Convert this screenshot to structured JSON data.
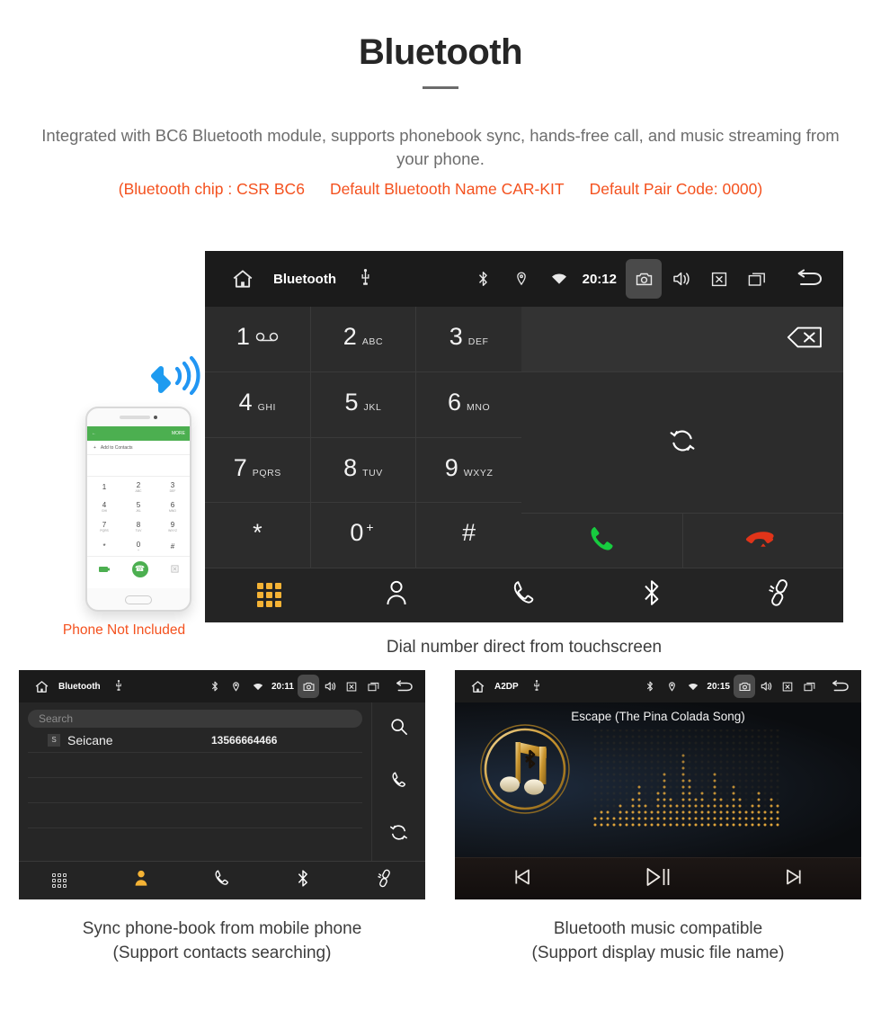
{
  "header": {
    "title": "Bluetooth",
    "lead": "Integrated with BC6 Bluetooth module, supports phonebook sync, hands-free call, and music streaming from your phone.",
    "spec_chip": "(Bluetooth chip : CSR BC6",
    "spec_name": "Default Bluetooth Name CAR-KIT",
    "spec_pair": "Default Pair Code: 0000)",
    "accent_color": "#f4511e",
    "text_color": "#6d6d6d"
  },
  "dialer": {
    "statusbar": {
      "home_icon": "home-icon",
      "title": "Bluetooth",
      "usb_icon": "usb-icon",
      "bluetooth_icon": "bluetooth-icon",
      "location_icon": "location-icon",
      "wifi_icon": "wifi-icon",
      "time": "20:12",
      "camera_icon": "camera-icon",
      "volume_icon": "volume-icon",
      "close_icon": "close-box-icon",
      "recents_icon": "recents-icon",
      "back_icon": "back-icon"
    },
    "keys": [
      {
        "digit": "1",
        "sub": "",
        "voicemail": true
      },
      {
        "digit": "2",
        "sub": "ABC"
      },
      {
        "digit": "3",
        "sub": "DEF"
      },
      {
        "digit": "4",
        "sub": "GHI"
      },
      {
        "digit": "5",
        "sub": "JKL"
      },
      {
        "digit": "6",
        "sub": "MNO"
      },
      {
        "digit": "7",
        "sub": "PQRS"
      },
      {
        "digit": "8",
        "sub": "TUV"
      },
      {
        "digit": "9",
        "sub": "WXYZ"
      },
      {
        "digit": "*",
        "sub": ""
      },
      {
        "digit": "0",
        "sup": "+"
      },
      {
        "digit": "#",
        "sub": ""
      }
    ],
    "number_input_value": "",
    "backspace_icon": "backspace-icon",
    "sync_icon": "sync-icon",
    "call_icon": "call-icon",
    "hangup_icon": "hangup-icon",
    "call_color": "#17cc3f",
    "hangup_color": "#e03419",
    "tabs": [
      {
        "name": "keypad",
        "icon": "keypad-icon",
        "active": true
      },
      {
        "name": "contacts",
        "icon": "contact-icon",
        "active": false
      },
      {
        "name": "call-log",
        "icon": "phone-handset-icon",
        "active": false
      },
      {
        "name": "bluetooth",
        "icon": "bluetooth-icon",
        "active": false
      },
      {
        "name": "link",
        "icon": "link-icon",
        "active": false
      }
    ],
    "active_tab_color": "#f5b335",
    "caption": "Dial number direct from touchscreen"
  },
  "phone_mockup": {
    "header_more": "MORE",
    "back_icon": "back-arrow-icon",
    "add_contacts": "Add to Contacts",
    "keys": [
      {
        "digit": "1",
        "sub": ""
      },
      {
        "digit": "2",
        "sub": "ABC"
      },
      {
        "digit": "3",
        "sub": "DEF"
      },
      {
        "digit": "4",
        "sub": "GHI"
      },
      {
        "digit": "5",
        "sub": "JKL"
      },
      {
        "digit": "6",
        "sub": "MNO"
      },
      {
        "digit": "7",
        "sub": "PQRS"
      },
      {
        "digit": "8",
        "sub": "TUV"
      },
      {
        "digit": "9",
        "sub": "WXYZ"
      },
      {
        "digit": "*",
        "sub": ""
      },
      {
        "digit": "0",
        "sub": "+"
      },
      {
        "digit": "#",
        "sub": ""
      }
    ],
    "call_icon": "call-icon",
    "note": "Phone Not Included",
    "note_color": "#f4511e",
    "bluetooth_badge_icon": "bluetooth-signal-icon",
    "badge_color": "#1e9bf0"
  },
  "phonebook": {
    "statusbar": {
      "title": "Bluetooth",
      "time": "20:11"
    },
    "search_placeholder": "Search",
    "search_value": "",
    "contacts": [
      {
        "initial": "S",
        "name": "Seicane",
        "number": "13566664466"
      },
      {
        "initial": "",
        "name": "",
        "number": ""
      },
      {
        "initial": "",
        "name": "",
        "number": ""
      },
      {
        "initial": "",
        "name": "",
        "number": ""
      }
    ],
    "side_actions": [
      {
        "name": "search",
        "icon": "search-icon"
      },
      {
        "name": "dial",
        "icon": "phone-handset-icon"
      },
      {
        "name": "sync",
        "icon": "sync-icon"
      }
    ],
    "tabs": [
      {
        "name": "keypad",
        "icon": "keypad-icon",
        "active": false
      },
      {
        "name": "contacts",
        "icon": "contact-icon",
        "active": true
      },
      {
        "name": "call-log",
        "icon": "phone-handset-icon",
        "active": false
      },
      {
        "name": "bluetooth",
        "icon": "bluetooth-icon",
        "active": false
      },
      {
        "name": "link",
        "icon": "link-icon",
        "active": false
      }
    ],
    "caption_line1": "Sync phone-book from mobile phone",
    "caption_line2": "(Support contacts searching)"
  },
  "music": {
    "statusbar": {
      "title": "A2DP",
      "time": "20:15"
    },
    "track_title": "Escape (The Pina Colada Song)",
    "album_art_icon": "music-note-bluetooth-icon",
    "accent_color": "#d9a441",
    "controls": [
      {
        "name": "previous",
        "icon": "skip-previous-icon"
      },
      {
        "name": "play-pause",
        "icon": "play-pause-icon"
      },
      {
        "name": "next",
        "icon": "skip-next-icon"
      }
    ],
    "caption_line1": "Bluetooth music compatible",
    "caption_line2": "(Support display music file name)"
  }
}
